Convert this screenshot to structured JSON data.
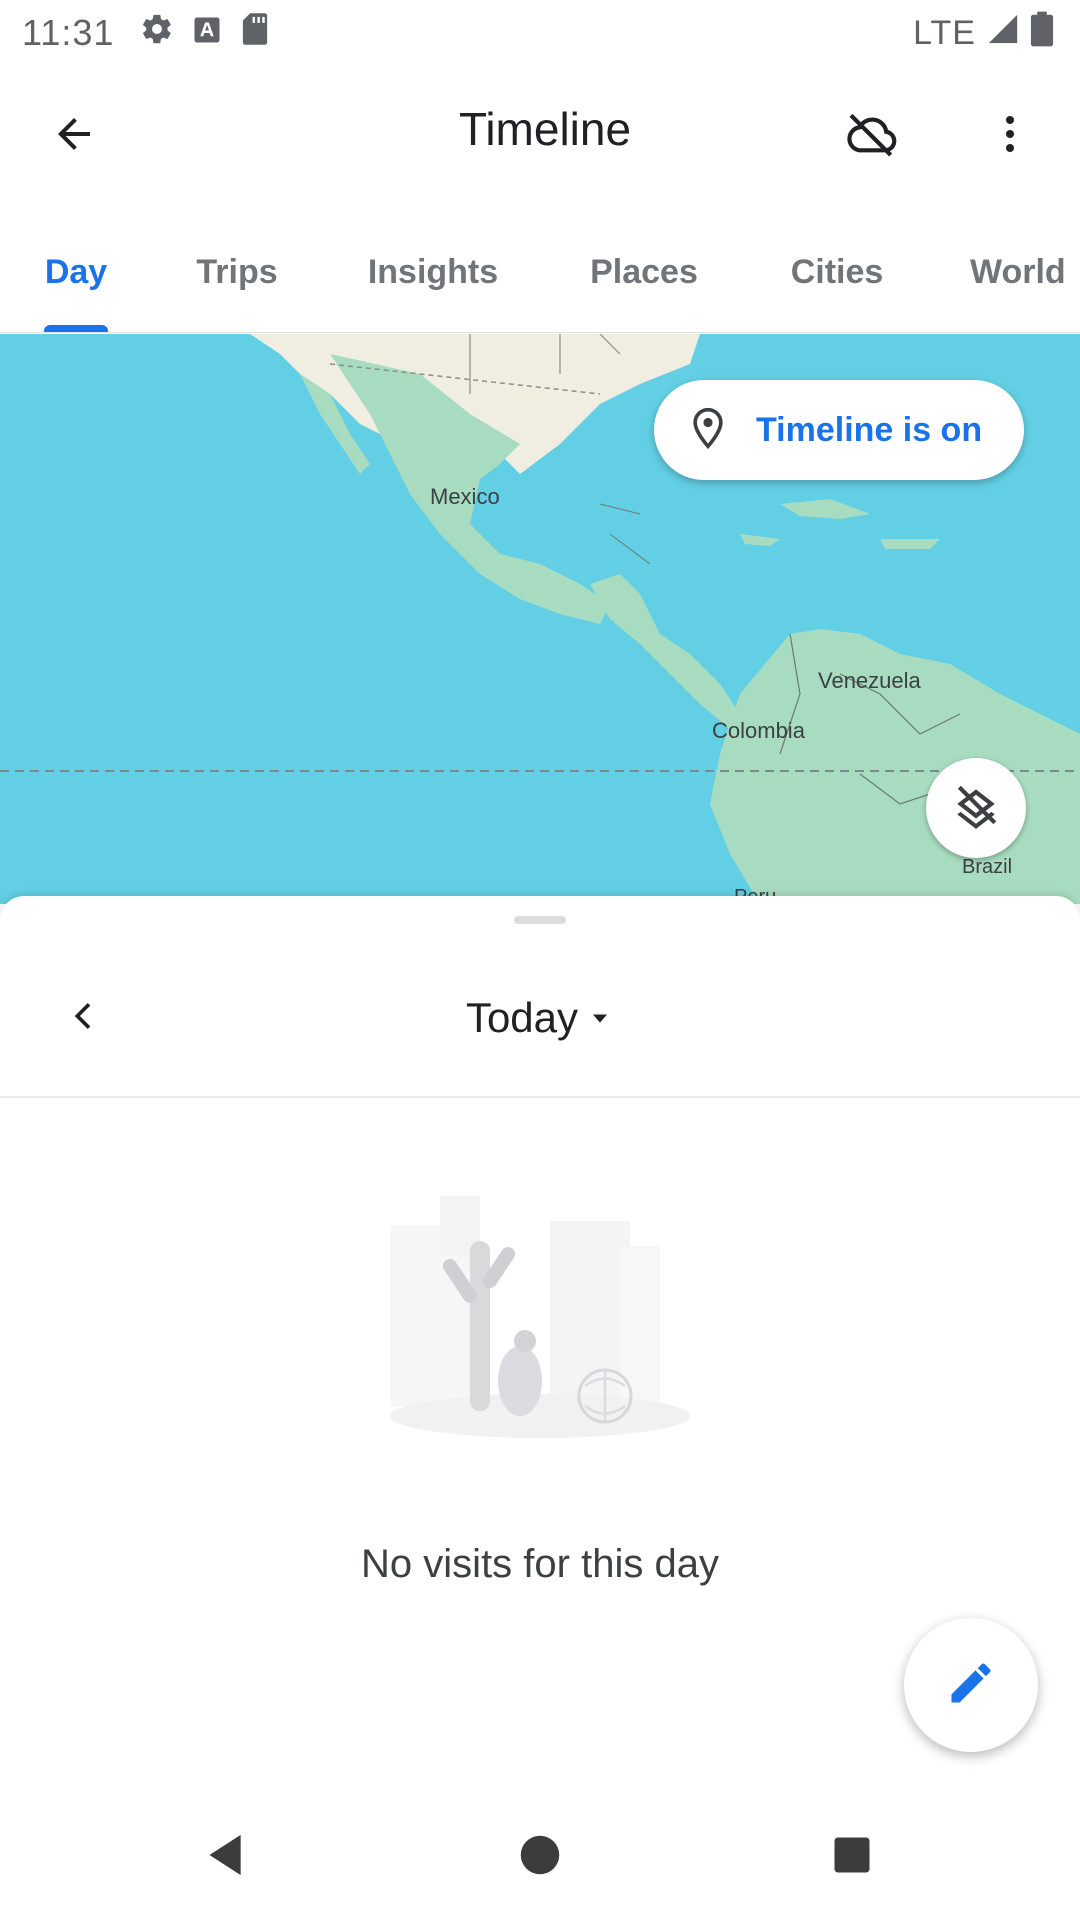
{
  "status_bar": {
    "time": "11:31",
    "network": "LTE",
    "icons": [
      "settings-icon",
      "font-icon",
      "sd-card-icon",
      "signal-icon",
      "battery-icon"
    ]
  },
  "app_bar": {
    "title": "Timeline",
    "icons": [
      "back-arrow-icon",
      "cloud-off-icon",
      "more-vert-icon"
    ]
  },
  "tabs": [
    {
      "label": "Day",
      "active": true
    },
    {
      "label": "Trips",
      "active": false
    },
    {
      "label": "Insights",
      "active": false
    },
    {
      "label": "Places",
      "active": false
    },
    {
      "label": "Cities",
      "active": false
    },
    {
      "label": "World",
      "active": false
    }
  ],
  "map": {
    "labels": [
      "Mexico",
      "Venezuela",
      "Colombia",
      "Brazil",
      "Peru"
    ],
    "chip_label": "Timeline is on",
    "colors": {
      "water": "#63cfe4",
      "land": "#a8dcc0",
      "north_land": "#efeee0"
    }
  },
  "sheet": {
    "date": "Today",
    "empty_message": "No visits for this day"
  },
  "colors": {
    "accent": "#1a73e8",
    "text_muted": "#70757a"
  }
}
